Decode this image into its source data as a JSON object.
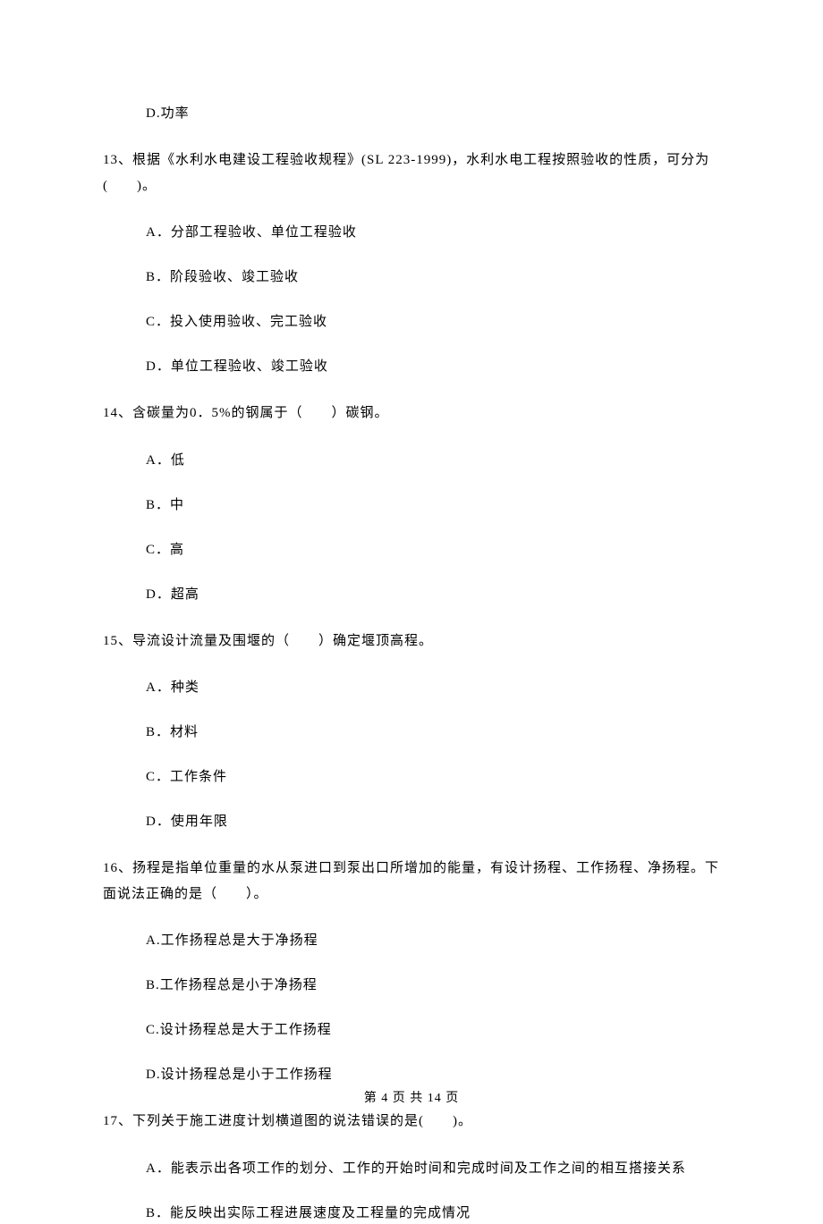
{
  "top_option": "D.功率",
  "q13": {
    "text": "13、根据《水利水电建设工程验收规程》(SL 223-1999)，水利水电工程按照验收的性质，可分为(　　)。",
    "a": "A．分部工程验收、单位工程验收",
    "b": "B．阶段验收、竣工验收",
    "c": "C．投入使用验收、完工验收",
    "d": "D．单位工程验收、竣工验收"
  },
  "q14": {
    "text": "14、含碳量为0．5%的钢属于（　　）碳钢。",
    "a": "A．低",
    "b": "B．中",
    "c": "C．高",
    "d": "D．超高"
  },
  "q15": {
    "text": "15、导流设计流量及围堰的（　　）确定堰顶高程。",
    "a": "A．种类",
    "b": "B．材料",
    "c": "C．工作条件",
    "d": "D．使用年限"
  },
  "q16": {
    "text": "16、扬程是指单位重量的水从泵进口到泵出口所增加的能量，有设计扬程、工作扬程、净扬程。下面说法正确的是（　　）。",
    "a": "A.工作扬程总是大于净扬程",
    "b": "B.工作扬程总是小于净扬程",
    "c": "C.设计扬程总是大于工作扬程",
    "d": "D.设计扬程总是小于工作扬程"
  },
  "q17": {
    "text": "17、下列关于施工进度计划横道图的说法错误的是(　　)。",
    "a": "A．能表示出各项工作的划分、工作的开始时间和完成时间及工作之间的相互搭接关系",
    "b": "B．能反映出实际工程进展速度及工程量的完成情况"
  },
  "footer": "第 4 页 共 14 页"
}
